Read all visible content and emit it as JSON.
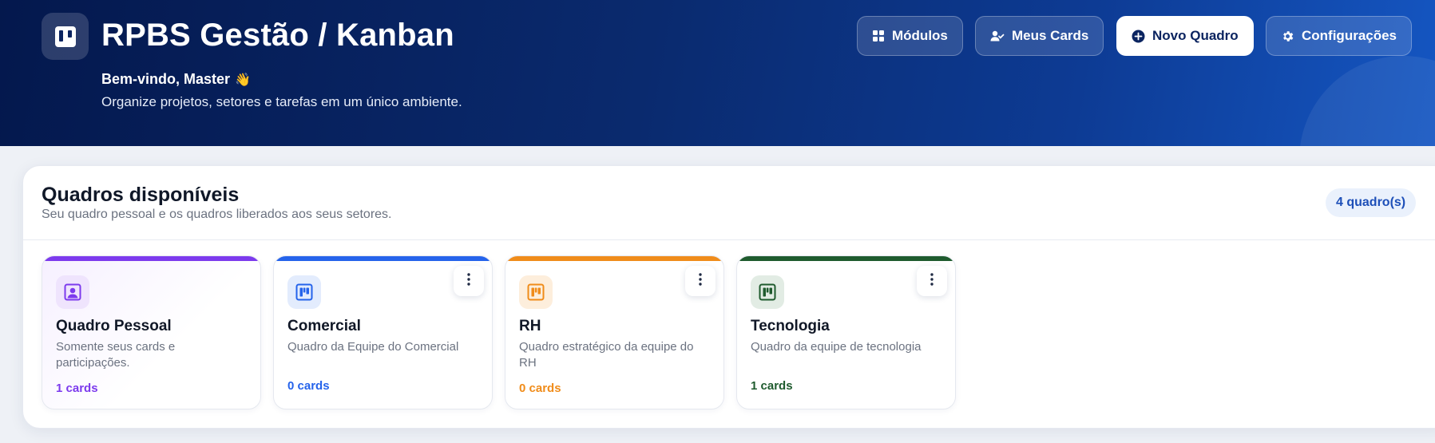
{
  "header": {
    "title": "RPBS Gestão / Kanban",
    "welcome": "Bem-vindo, Master",
    "welcome_emoji": "👋",
    "tagline": "Organize projetos, setores e tarefas em um único ambiente.",
    "buttons": {
      "modules": "Módulos",
      "my_cards": "Meus Cards",
      "new_board": "Novo Quadro",
      "settings": "Configurações"
    }
  },
  "boards_panel": {
    "title": "Quadros disponíveis",
    "subtitle": "Seu quadro pessoal e os quadros liberados aos seus setores.",
    "count_badge": "4 quadro(s)",
    "boards": [
      {
        "title": "Quadro Pessoal",
        "description": "Somente seus cards e participações.",
        "count": "1 cards",
        "color": "#7c3aed",
        "icon": "user-portrait-icon"
      },
      {
        "title": "Comercial",
        "description": "Quadro da Equipe do Comercial",
        "count": "0 cards",
        "color": "#2563eb",
        "icon": "kanban-icon"
      },
      {
        "title": "RH",
        "description": "Quadro estratégico da equipe do RH",
        "count": "0 cards",
        "color": "#f08c1a",
        "icon": "kanban-icon"
      },
      {
        "title": "Tecnologia",
        "description": "Quadro da equipe de tecnologia",
        "count": "1 cards",
        "color": "#1f5b2e",
        "icon": "kanban-icon"
      }
    ]
  },
  "colors": {
    "header_dark": "#04184d",
    "header_light": "#1556c2",
    "accent_blue": "#1d4fb8"
  }
}
